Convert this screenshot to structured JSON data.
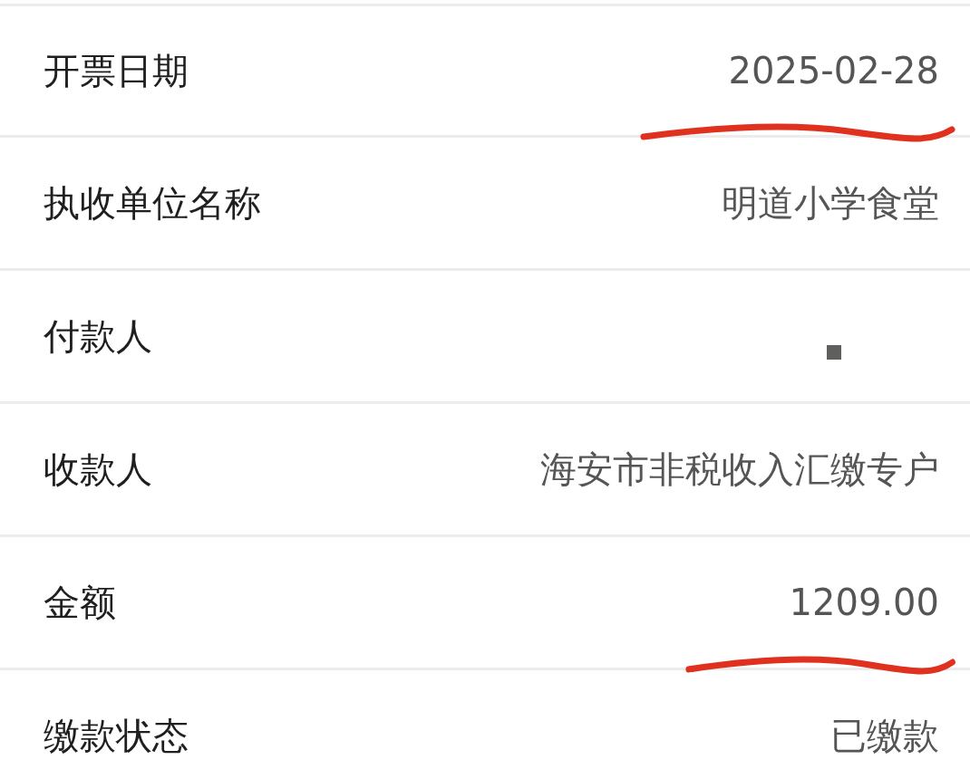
{
  "rows": [
    {
      "label": "开票日期",
      "value": "2025-02-28",
      "underlined": true
    },
    {
      "label": "执收单位名称",
      "value": "明道小学食堂"
    },
    {
      "label": "付款人",
      "redacted": true
    },
    {
      "label": "收款人",
      "value": "海安市非税收入汇缴专户"
    },
    {
      "label": "金额",
      "value": "1209.00",
      "underlined": true
    },
    {
      "label": "缴款状态",
      "value": "已缴款"
    }
  ]
}
